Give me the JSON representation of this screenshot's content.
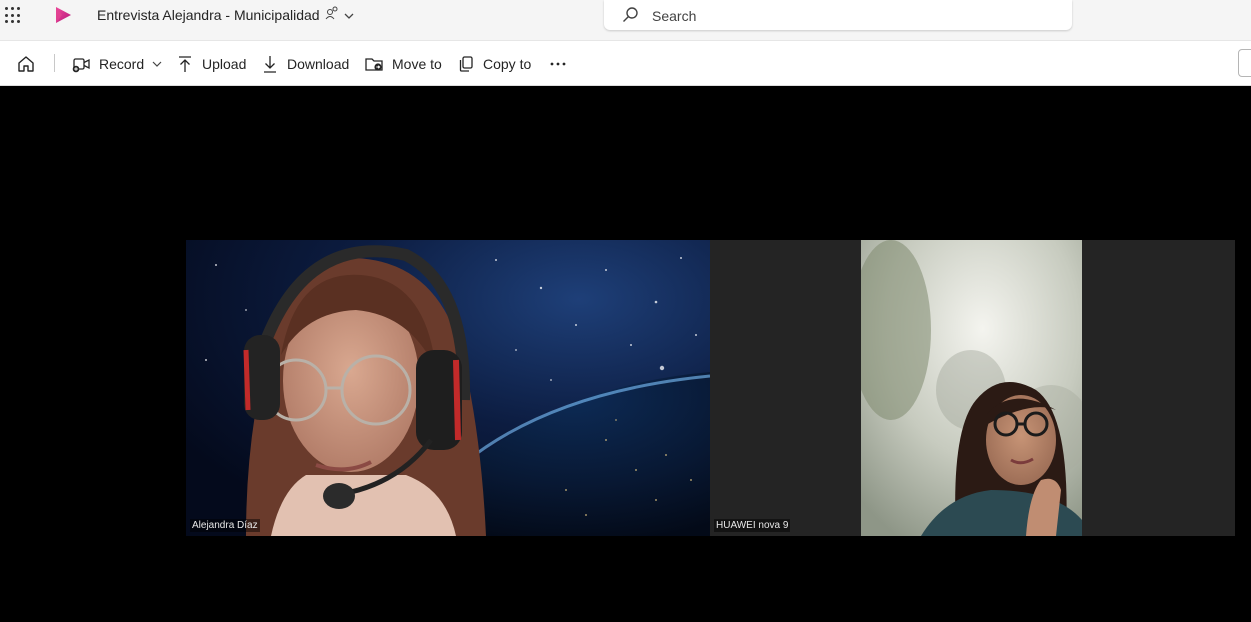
{
  "topbar": {
    "app_grid_icon": "waffle-grid-icon",
    "app_logo_icon": "stream-play-icon",
    "title": "Entrevista Alejandra - Municipalidad",
    "share_icon": "people-chevron-icon",
    "search_placeholder": "Search"
  },
  "toolbar": {
    "home_icon": "home-icon",
    "record_label": "Record",
    "upload_label": "Upload",
    "download_label": "Download",
    "move_label": "Move to",
    "copy_label": "Copy to",
    "more_icon": "ellipsis-icon"
  },
  "video": {
    "participants": [
      {
        "name": "Alejandra Díaz"
      },
      {
        "name": "HUAWEI nova 9"
      }
    ]
  },
  "colors": {
    "app_brand": "#d11b8a",
    "topbar_bg": "#f5f5f5",
    "stage_bg": "#000000",
    "tile_bg": "#242424"
  }
}
